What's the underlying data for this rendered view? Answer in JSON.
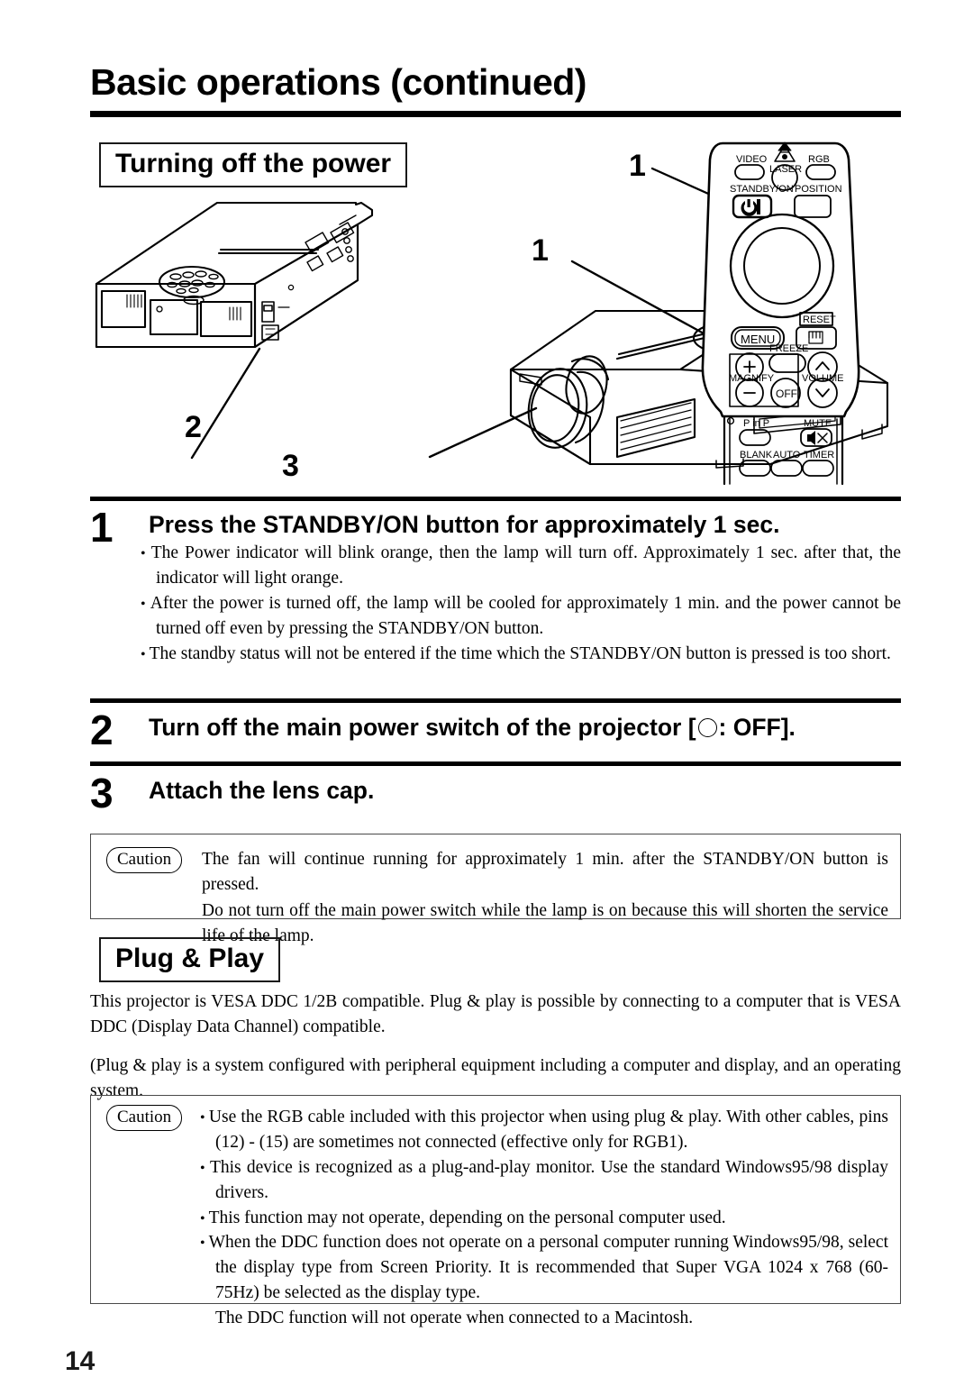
{
  "document": {
    "title": "Basic operations (continued)",
    "page_number": "14"
  },
  "sections": {
    "turning_off": {
      "heading": "Turning off the power"
    },
    "plug_play": {
      "heading": "Plug & Play",
      "paragraph_1": "This projector is VESA DDC 1/2B compatible. Plug & play is possible by connecting to a computer that is VESA DDC (Display Data Channel) compatible.",
      "paragraph_2": "(Plug & play is a system configured with peripheral equipment including a computer and display, and an operating system."
    }
  },
  "illustration": {
    "callouts": [
      {
        "label": "1",
        "target": "remote-standby-on-button"
      },
      {
        "label": "1",
        "target": "projector-control-panel"
      },
      {
        "label": "2",
        "target": "projector-main-power-switch"
      },
      {
        "label": "3",
        "target": "projector-lens-cap"
      }
    ],
    "remote": {
      "buttons": [
        "VIDEO",
        "LASER",
        "RGB",
        "STANDBY/ON",
        "POSITION",
        "RESET",
        "MENU",
        "FREEZE",
        "MAGNIFY",
        "VOLUME",
        "OFF",
        "P in P",
        "MUTE",
        "BLANK",
        "AUTO",
        "TIMER"
      ],
      "labels": {
        "video": "VIDEO",
        "laser": "LASER",
        "rgb": "RGB",
        "standby_on": "STANDBY/ON",
        "position": "POSITION",
        "reset": "RESET",
        "menu": "MENU",
        "freeze": "FREEZE",
        "magnify": "MAGNIFY",
        "volume": "VOLUME",
        "off": "OFF",
        "plus": "+",
        "minus": "–",
        "pinp": "P in P",
        "mute": "MUTE",
        "blank": "BLANK",
        "auto": "AUTO",
        "timer": "TIMER"
      }
    }
  },
  "steps": [
    {
      "number": "1",
      "heading": "Press the STANDBY/ON button for approximately 1 sec.",
      "bullets": [
        "The Power indicator will blink orange, then the lamp will turn off. Approximately 1 sec. after that, the indicator will light orange.",
        "After the power is turned off, the lamp will be cooled for approximately 1 min. and the power cannot be turned off even by pressing the STANDBY/ON button.",
        "The standby status will not be entered if the time which the STANDBY/ON button is pressed is too short."
      ]
    },
    {
      "number": "2",
      "heading_before": "Turn off the main power switch of the projector [",
      "heading_symbol": "circle-outline",
      "heading_after": ": OFF]."
    },
    {
      "number": "3",
      "heading": "Attach the lens cap."
    }
  ],
  "caution_power": {
    "tag": "Caution",
    "line_1": "The fan will continue running for approximately 1 min. after the STANDBY/ON button is pressed.",
    "line_2": "Do not turn off the main power switch while the lamp is on because this will shorten the service life of the lamp."
  },
  "caution_plug_play": {
    "tag": "Caution",
    "bullets": [
      "Use the RGB cable included with this projector when using plug & play. With other cables, pins (12) - (15) are sometimes not connected (effective only for RGB1).",
      "This device is recognized as a plug-and-play monitor. Use the standard Windows95/98 display drivers.",
      "This function may not operate, depending on the personal computer used.",
      "When the DDC function does not operate on a personal computer running Windows95/98, select the display type from Screen Priority. It is recommended that Super VGA 1024 x 768 (60-75Hz)  be selected as the display type."
    ],
    "trailing_line": "The DDC function will not operate when connected to a Macintosh."
  },
  "colors": {
    "ink": "#000000",
    "rule": "#000000",
    "box_border": "#4a4a4a"
  }
}
